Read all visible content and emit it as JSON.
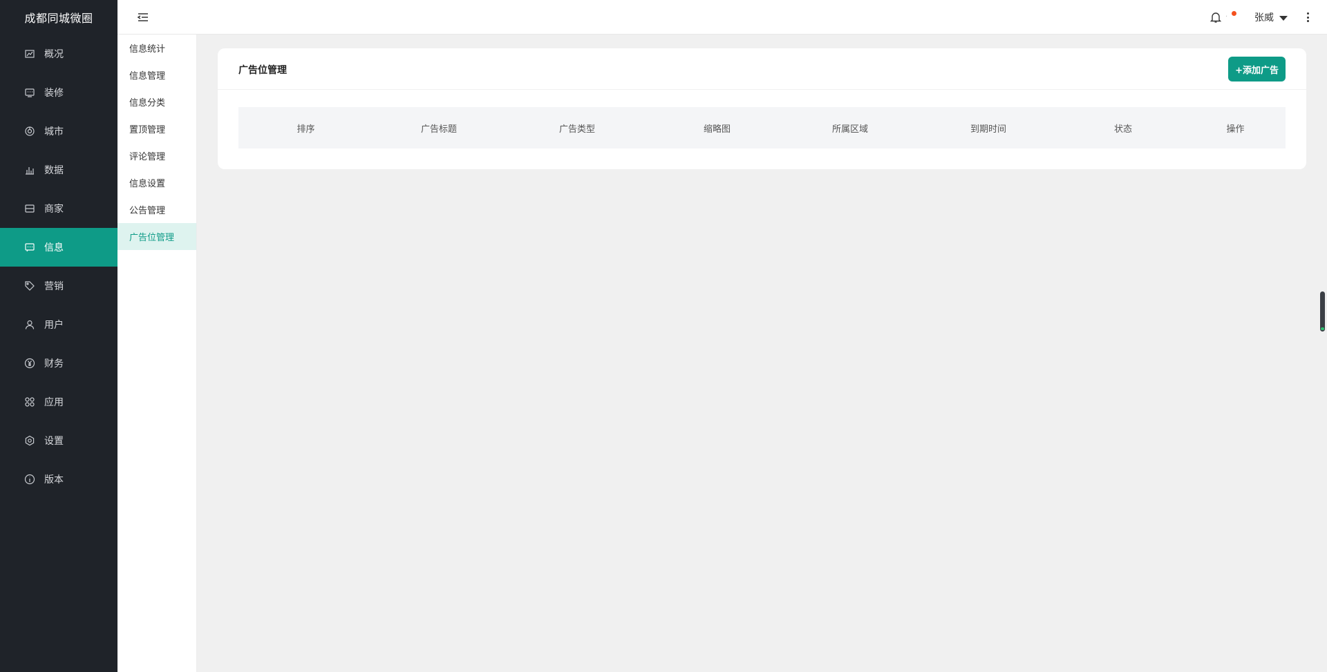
{
  "brand": "成都同城微圈",
  "nav": [
    {
      "label": "概况",
      "icon": "overview-icon"
    },
    {
      "label": "装修",
      "icon": "decoration-icon"
    },
    {
      "label": "城市",
      "icon": "city-icon"
    },
    {
      "label": "数据",
      "icon": "data-chart-icon"
    },
    {
      "label": "商家",
      "icon": "merchant-icon"
    },
    {
      "label": "信息",
      "icon": "message-icon",
      "active": true
    },
    {
      "label": "营销",
      "icon": "tag-icon"
    },
    {
      "label": "用户",
      "icon": "user-icon"
    },
    {
      "label": "财务",
      "icon": "yen-icon"
    },
    {
      "label": "应用",
      "icon": "apps-icon"
    },
    {
      "label": "设置",
      "icon": "settings-icon"
    },
    {
      "label": "版本",
      "icon": "info-icon"
    }
  ],
  "submenu": [
    {
      "label": "信息统计"
    },
    {
      "label": "信息管理"
    },
    {
      "label": "信息分类"
    },
    {
      "label": "置顶管理"
    },
    {
      "label": "评论管理"
    },
    {
      "label": "信息设置"
    },
    {
      "label": "公告管理"
    },
    {
      "label": "广告位管理",
      "active": true
    }
  ],
  "header": {
    "user_name": "张威",
    "notification_icon": "bell-icon"
  },
  "card": {
    "title": "广告位管理",
    "add_button": "+添加广告",
    "columns": [
      "排序",
      "广告标题",
      "广告类型",
      "缩略图",
      "所属区域",
      "到期时间",
      "状态",
      "操作"
    ]
  },
  "colors": {
    "accent": "#0e9b87",
    "sidebar_bg": "#1f2329",
    "notification_dot": "#f4511e"
  }
}
